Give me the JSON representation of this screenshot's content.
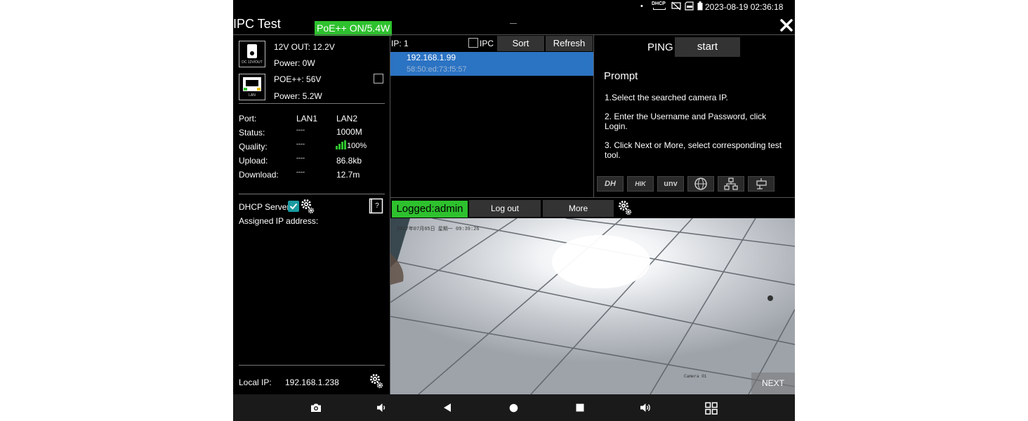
{
  "status_bar": {
    "dot": "•",
    "dhcp_label": "DHCP",
    "datetime": "2023-08-19 02:36:18",
    "icons": [
      "dhcp-icon",
      "no-screen-icon",
      "sd-card-icon",
      "battery-icon"
    ]
  },
  "header": {
    "title": "IPC Test",
    "poe_badge": "PoE++ ON/5.4W",
    "close_icon": "close-icon"
  },
  "power": {
    "dc_out_label": "12V OUT: 12.2V",
    "dc_power_label": "Power: 0W",
    "dc_icon_text": "DC 12V/OUT",
    "poe_label": "POE++: 56V",
    "poe_power_label": "Power: 5.2W",
    "lan_icon_text": "LAN"
  },
  "ports": {
    "port_label": "Port:",
    "lan1": "LAN1",
    "lan2": "LAN2",
    "rows": [
      {
        "label": "Status:",
        "lan1": "----",
        "lan2": "1000M"
      },
      {
        "label": "Quality:",
        "lan1": "----",
        "lan2": "100%"
      },
      {
        "label": "Upload:",
        "lan1": "----",
        "lan2": "86.8kb"
      },
      {
        "label": "Download:",
        "lan1": "----",
        "lan2": "12.7m"
      }
    ]
  },
  "dhcp": {
    "server_label": "DHCP Server:",
    "assigned_label": "Assigned IP address:"
  },
  "local": {
    "label": "Local IP:",
    "ip": "192.168.1.238"
  },
  "ip_list": {
    "count_label": "IP: 1",
    "ipc_label": "IPC",
    "sort_label": "Sort",
    "refresh_label": "Refresh",
    "items": [
      {
        "ip": "192.168.1.99",
        "mac": "58:50:ed:73:f5:57"
      }
    ]
  },
  "ping": {
    "label": "PING",
    "start_label": "start"
  },
  "prompt": {
    "title": "Prompt",
    "step1": "1.Select the searched camera IP.",
    "step2": "2. Enter the Username and Password, click Login.",
    "step3": "3. Click Next or More, select corresponding test tool."
  },
  "brands": [
    "DH",
    "HIK",
    "unv"
  ],
  "session": {
    "logged_label": "Logged:admin",
    "logout_label": "Log out",
    "more_label": "More"
  },
  "camera": {
    "osd_time": "2027年07月05日 星期一 09:39:26",
    "osd_name": "Camera 01",
    "next_label": "NEXT"
  },
  "nav_icons": [
    "camera-icon",
    "volume-down-icon",
    "back-icon",
    "home-icon",
    "recents-icon",
    "volume-up-icon",
    "apps-icon"
  ]
}
